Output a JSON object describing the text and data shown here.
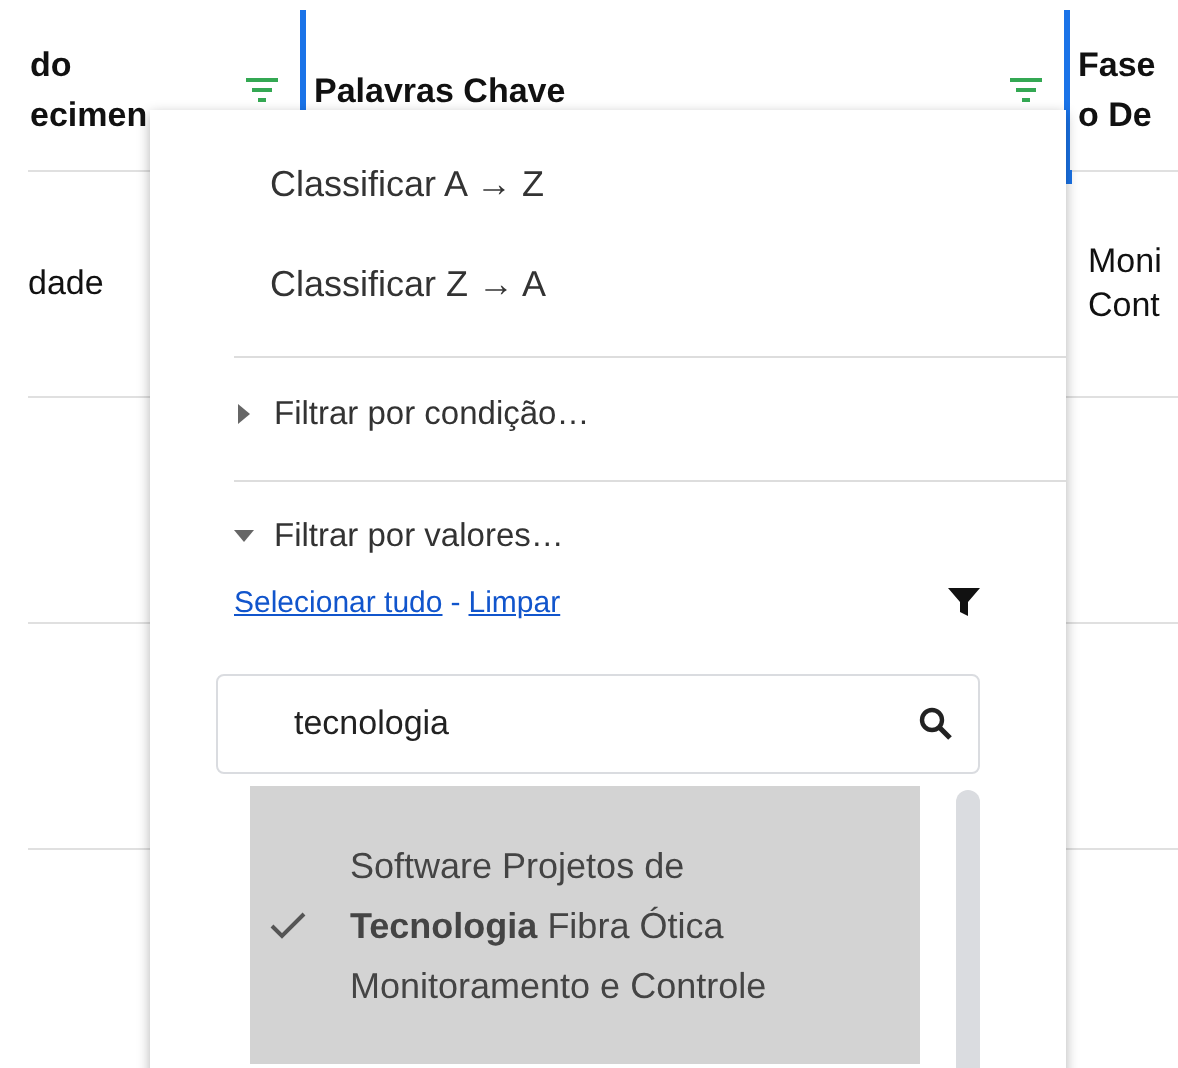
{
  "columns": [
    {
      "lines": [
        "do",
        "ecimen"
      ],
      "filtered": true,
      "selected": false
    },
    {
      "lines": [
        "Palavras Chave"
      ],
      "filtered": true,
      "selected": true
    },
    {
      "lines": [
        "Fase",
        "o De"
      ],
      "filtered": false,
      "selected": false
    }
  ],
  "rows": [
    {
      "cells": [
        [
          "dade"
        ],
        [],
        [
          "Moni",
          "Cont"
        ]
      ]
    }
  ],
  "menu": {
    "sort_items": [
      "Classificar A → Z",
      "Classificar Z → A"
    ],
    "sections": [
      {
        "label": "Filtrar por condição…",
        "expanded": false
      },
      {
        "label": "Filtrar por valores…",
        "expanded": true
      }
    ],
    "select_all": "Selecionar tudo",
    "separator": "-",
    "clear": "Limpar",
    "search": {
      "value": "tecnologia"
    },
    "values": [
      {
        "text": "Software Projetos de **Tecnologia** Fibra Ótica Monitoramento e Controle",
        "checked": true,
        "selected": true
      }
    ]
  }
}
